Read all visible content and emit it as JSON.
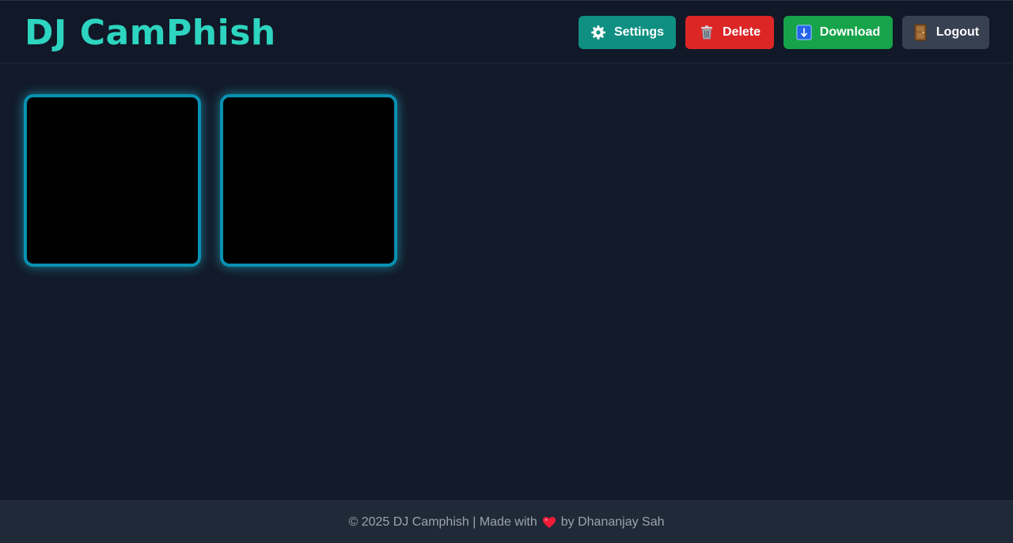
{
  "header": {
    "brand": "DJ CamPhish",
    "buttons": {
      "settings": {
        "label": "Settings",
        "icon": "gear-icon"
      },
      "delete": {
        "label": "Delete",
        "icon": "trash-icon"
      },
      "download": {
        "label": "Download",
        "icon": "download-arrow-icon"
      },
      "logout": {
        "label": "Logout",
        "icon": "door-icon"
      }
    }
  },
  "main": {
    "tiles": [
      {
        "content": ""
      },
      {
        "content": ""
      }
    ]
  },
  "footer": {
    "prefix": "© 2025 DJ Camphish | Made with",
    "icon": "heart-icon",
    "suffix": "by Dhananjay Sah"
  },
  "colors": {
    "brand": "#2dd4bf",
    "settings": "#0f8f82",
    "delete": "#dc2626",
    "download": "#16a34a",
    "logout": "#374151",
    "tile_border": "#0891b2"
  }
}
